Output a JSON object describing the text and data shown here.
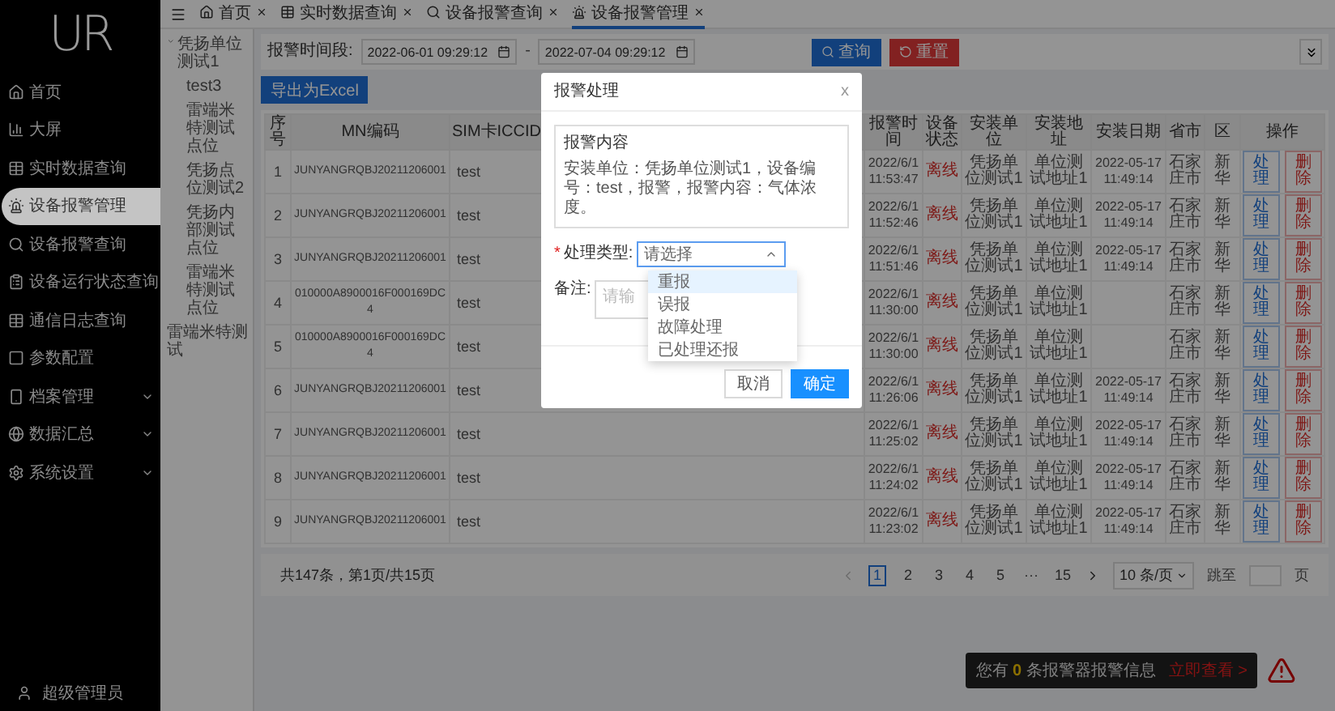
{
  "sidebar": {
    "logo": "UR",
    "items": [
      {
        "label": "首页",
        "selected": false
      },
      {
        "label": "大屏",
        "selected": false
      },
      {
        "label": "实时数据查询",
        "selected": false
      },
      {
        "label": "设备报警管理",
        "selected": true
      },
      {
        "label": "设备报警查询",
        "selected": false
      },
      {
        "label": "设备运行状态查询",
        "selected": false
      },
      {
        "label": "通信日志查询",
        "selected": false
      },
      {
        "label": "参数配置",
        "selected": false
      },
      {
        "label": "档案管理",
        "selected": false,
        "expandable": true
      },
      {
        "label": "数据汇总",
        "selected": false,
        "expandable": true
      },
      {
        "label": "系统设置",
        "selected": false,
        "expandable": true
      }
    ],
    "user": "超级管理员"
  },
  "tabs": [
    {
      "label": "首页",
      "selected": false
    },
    {
      "label": "实时数据查询",
      "selected": false
    },
    {
      "label": "设备报警查询",
      "selected": false
    },
    {
      "label": "设备报警管理",
      "selected": true
    }
  ],
  "tree": [
    {
      "label": "凭扬单位测试1",
      "expanded": true,
      "children": [
        {
          "label": "test3"
        },
        {
          "label": "雷端米特测试点位"
        },
        {
          "label": "凭扬点位测试2"
        },
        {
          "label": "凭扬内部测试点位"
        },
        {
          "label": "雷端米特测试点位"
        }
      ]
    },
    {
      "label": "雷端米特测试"
    }
  ],
  "filter": {
    "label": "报警时间段:",
    "start": "2022-06-01 09:29:12",
    "separator": "-",
    "end": "2022-07-04 09:29:12",
    "buttons": [
      {
        "label": "查询",
        "kind": "search"
      },
      {
        "label": "重置",
        "kind": "reset"
      }
    ]
  },
  "export_button": "导出为Excel",
  "table": {
    "columns": [
      "序号",
      "MN编码",
      "SIM卡ICCID",
      "报警时间",
      "设备状态",
      "安装单位",
      "安装地址",
      "安装日期",
      "省市",
      "区",
      "操作"
    ],
    "rows": [
      {
        "no": "1",
        "mn": "JUNYANGRQBJ20211206001",
        "sim": "test",
        "time": "2022/6/1 11:53:47",
        "status": "离线",
        "unit": "凭扬单位测试1",
        "address": "单位测试地址1",
        "date": "2022-05-17 11:49:14",
        "city": "石家庄市",
        "district": "新华",
        "actions": [
          {
            "label": "处理",
            "kind": "edit"
          },
          {
            "label": "删除",
            "kind": "delete"
          }
        ]
      },
      {
        "no": "2",
        "mn": "JUNYANGRQBJ20211206001",
        "sim": "test",
        "time": "2022/6/1 11:52:46",
        "status": "离线",
        "unit": "凭扬单位测试1",
        "address": "单位测试地址1",
        "date": "2022-05-17 11:49:14",
        "city": "石家庄市",
        "district": "新华",
        "actions": [
          {
            "label": "处理",
            "kind": "edit"
          },
          {
            "label": "删除",
            "kind": "delete"
          }
        ]
      },
      {
        "no": "3",
        "mn": "JUNYANGRQBJ20211206001",
        "sim": "test",
        "time": "2022/6/1 11:51:46",
        "status": "离线",
        "unit": "凭扬单位测试1",
        "address": "单位测试地址1",
        "date": "2022-05-17 11:49:14",
        "city": "石家庄市",
        "district": "新华",
        "actions": [
          {
            "label": "处理",
            "kind": "edit"
          },
          {
            "label": "删除",
            "kind": "delete"
          }
        ]
      },
      {
        "no": "4",
        "mn": "010000A8900016F000169DC4",
        "sim": "test",
        "time": "2022/6/1 11:30:00",
        "status": "离线",
        "unit": "凭扬单位测试1",
        "address": "单位测试地址1",
        "city": "石家庄市",
        "district": "新华",
        "actions": [
          {
            "label": "处理",
            "kind": "edit"
          },
          {
            "label": "删除",
            "kind": "delete"
          }
        ]
      },
      {
        "no": "5",
        "mn": "010000A8900016F000169DC4",
        "sim": "test",
        "time": "2022/6/1 11:30:00",
        "status": "离线",
        "unit": "凭扬单位测试1",
        "address": "单位测试地址1",
        "city": "石家庄市",
        "district": "新华",
        "actions": [
          {
            "label": "处理",
            "kind": "edit"
          },
          {
            "label": "删除",
            "kind": "delete"
          }
        ]
      },
      {
        "no": "6",
        "mn": "JUNYANGRQBJ20211206001",
        "sim": "test",
        "time": "2022/6/1 11:26:06",
        "status": "离线",
        "unit": "凭扬单位测试1",
        "address": "单位测试地址1",
        "date": "2022-05-17 11:49:14",
        "city": "石家庄市",
        "district": "新华",
        "actions": [
          {
            "label": "处理",
            "kind": "edit"
          },
          {
            "label": "删除",
            "kind": "delete"
          }
        ]
      },
      {
        "no": "7",
        "mn": "JUNYANGRQBJ20211206001",
        "sim": "test",
        "time": "2022/6/1 11:25:02",
        "status": "离线",
        "unit": "凭扬单位测试1",
        "address": "单位测试地址1",
        "date": "2022-05-17 11:49:14",
        "city": "石家庄市",
        "district": "新华",
        "actions": [
          {
            "label": "处理",
            "kind": "edit"
          },
          {
            "label": "删除",
            "kind": "delete"
          }
        ]
      },
      {
        "no": "8",
        "mn": "JUNYANGRQBJ20211206001",
        "sim": "test",
        "time": "2022/6/1 11:24:02",
        "status": "离线",
        "unit": "凭扬单位测试1",
        "address": "单位测试地址1",
        "date": "2022-05-17 11:49:14",
        "city": "石家庄市",
        "district": "新华",
        "actions": [
          {
            "label": "处理",
            "kind": "edit"
          },
          {
            "label": "删除",
            "kind": "delete"
          }
        ]
      },
      {
        "no": "9",
        "mn": "JUNYANGRQBJ20211206001",
        "sim": "test",
        "time": "2022/6/1 11:23:02",
        "status": "离线",
        "unit": "凭扬单位测试1",
        "address": "单位测试地址1",
        "date": "2022-05-17 11:49:14",
        "city": "石家庄市",
        "district": "新华",
        "actions": [
          {
            "label": "处理",
            "kind": "edit"
          },
          {
            "label": "删除",
            "kind": "delete"
          }
        ]
      }
    ]
  },
  "pagination": {
    "summary": "共147条，第1页/共15页",
    "pages": [
      {
        "label": "1",
        "selected": true
      },
      {
        "label": "2",
        "selected": false
      },
      {
        "label": "3",
        "selected": false
      },
      {
        "label": "4",
        "selected": false
      },
      {
        "label": "5",
        "selected": false
      },
      {
        "label": "···",
        "selected": false
      },
      {
        "label": "15",
        "selected": false
      }
    ],
    "page_size": "10 条/页",
    "jump_label": "跳至",
    "jump_unit": "页"
  },
  "notice": {
    "prefix": "您有",
    "count": "0",
    "suffix": "条报警器报警信息",
    "link": "立即查看 >"
  },
  "modal": {
    "title": "报警处理",
    "close": "x",
    "content_title": "报警内容",
    "content": "安装单位：凭扬单位测试1，设备编号：test，报警，报警内容：气体浓度。",
    "fields": [
      {
        "label": "处理类型:",
        "required_mark": "*",
        "kind": "select",
        "placeholder": "请选择",
        "expanded": true,
        "options": [
          {
            "label": "重报",
            "highlighted": true
          },
          {
            "label": "误报",
            "highlighted": false
          },
          {
            "label": "故障处理",
            "highlighted": false
          },
          {
            "label": "已处理还报",
            "highlighted": false
          }
        ]
      },
      {
        "label": "备注:",
        "kind": "textarea",
        "placeholder": "请输"
      }
    ],
    "buttons": [
      {
        "label": "取消",
        "kind": "cancel"
      },
      {
        "label": "确定",
        "kind": "primary"
      }
    ]
  }
}
